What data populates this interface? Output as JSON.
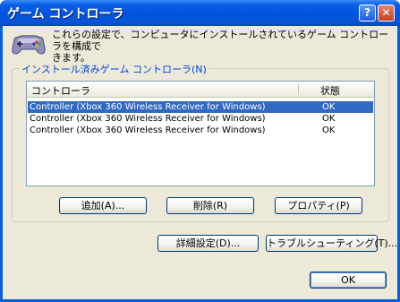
{
  "window": {
    "title": "ゲーム コントローラ",
    "help_button": "?",
    "close_button": "✕",
    "icon": "gamepad-icon"
  },
  "intro_text": "これらの設定で、コンピュータにインストールされているゲーム コントローラを構成で\nきます。",
  "group": {
    "label": "インストール済みゲーム コントローラ(N)"
  },
  "list": {
    "columns": [
      "コントローラ",
      "状態"
    ],
    "rows": [
      {
        "name": "Controller (Xbox 360 Wireless Receiver for Windows)",
        "status": "OK",
        "selected": true
      },
      {
        "name": "Controller (Xbox 360 Wireless Receiver for Windows)",
        "status": "OK",
        "selected": false
      },
      {
        "name": "Controller (Xbox 360 Wireless Receiver for Windows)",
        "status": "OK",
        "selected": false
      }
    ]
  },
  "buttons": {
    "add": "追加(A)...",
    "remove": "削除(R)",
    "properties": "プロパティ(P)",
    "advanced": "詳細設定(D)...",
    "troubleshoot": "トラブルシューティング(T)...",
    "ok": "OK"
  },
  "colors": {
    "titlebar": "#0053e0",
    "selection": "#316ac5",
    "group_label": "#0046d5",
    "dialog_bg": "#ece9d8"
  }
}
